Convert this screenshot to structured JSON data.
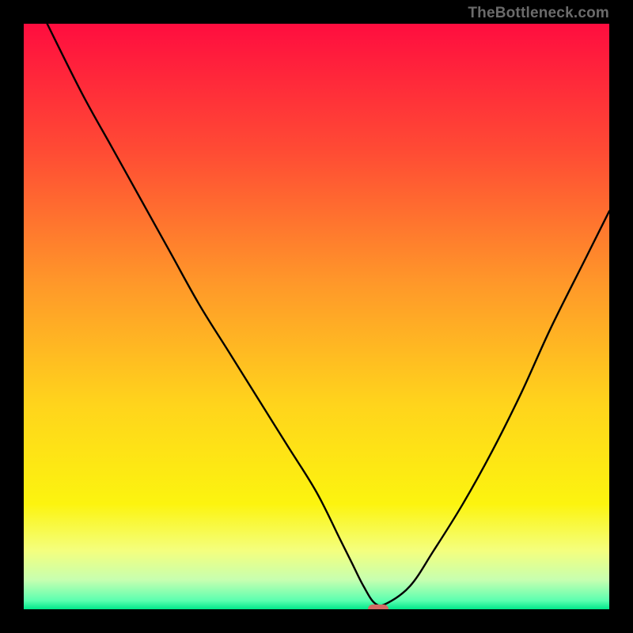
{
  "attribution": "TheBottleneck.com",
  "chart_data": {
    "type": "line",
    "title": "",
    "xlabel": "",
    "ylabel": "",
    "xlim": [
      0,
      100
    ],
    "ylim": [
      0,
      100
    ],
    "grid": false,
    "series": [
      {
        "name": "bottleneck-curve",
        "x": [
          4,
          10,
          15,
          20,
          25,
          30,
          35,
          40,
          45,
          50,
          54,
          56,
          58,
          60,
          62,
          66,
          70,
          75,
          80,
          85,
          90,
          96,
          100
        ],
        "values": [
          100,
          88,
          79,
          70,
          61,
          52,
          44,
          36,
          28,
          20,
          12,
          8,
          4,
          1,
          1,
          4,
          10,
          18,
          27,
          37,
          48,
          60,
          68
        ]
      }
    ],
    "gradient_stops": [
      {
        "offset": 0,
        "color": "#ff0d3f"
      },
      {
        "offset": 0.22,
        "color": "#ff4c34"
      },
      {
        "offset": 0.45,
        "color": "#ff9a29"
      },
      {
        "offset": 0.65,
        "color": "#ffd41c"
      },
      {
        "offset": 0.82,
        "color": "#fcf40f"
      },
      {
        "offset": 0.9,
        "color": "#f4ff7e"
      },
      {
        "offset": 0.95,
        "color": "#c7ffb0"
      },
      {
        "offset": 0.985,
        "color": "#5cffb0"
      },
      {
        "offset": 1.0,
        "color": "#00e88a"
      }
    ],
    "marker": {
      "x": 60.5,
      "y": 0,
      "width_pct": 3.5,
      "height_pct": 1.6,
      "color": "#d46a63"
    },
    "curve_color": "#000000"
  }
}
